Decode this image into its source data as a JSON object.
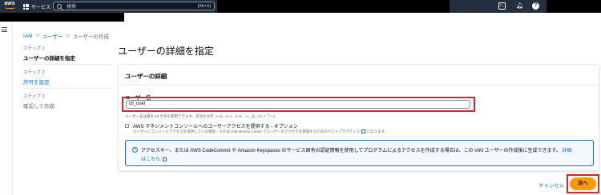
{
  "topbar": {
    "logo_text": "aws",
    "services_label": "サービス",
    "search_placeholder": "検索",
    "search_shortcut": "[Alt+S]",
    "cloudshell_icon": "cloudshell-icon",
    "bell_icon": "bell-icon",
    "help_icon": "help-icon"
  },
  "breadcrumb": {
    "items": [
      "IAM",
      "ユーザー"
    ],
    "separator": ">",
    "current": "ユーザーの作成"
  },
  "steps": [
    {
      "num": "ステップ 1",
      "title": "ユーザーの詳細を指定",
      "state": "active"
    },
    {
      "num": "ステップ 2",
      "title": "許可を設定",
      "state": "link"
    },
    {
      "num": "ステップ 3",
      "title": "確認して作成",
      "state": "inactive"
    }
  ],
  "page_title": "ユーザーの詳細を指定",
  "panel": {
    "header": "ユーザーの詳細",
    "username_label": "ユーザー名",
    "username_value": "cli_user",
    "constraint": "ユーザー名は最大 64 文字を使用できます。有効な文字: A~Z、a~z、0~9、+=,.@_-(ハイフン)",
    "console_access_label": "AWS マネジメントコンソールへのユーザーアクセスを提供する - オプション",
    "console_access_desc": "ユーザーにコンソールアクセスを提供している場合、それは IAM Identity Center でユーザーのアクセスを管理するためのベストプラクティス",
    "console_access_desc_suffix": "になります。",
    "info_text": "アクセスキー、または AWS CodeCommit や Amazon Keyspaces のサービス固有の認証情報を使用してプログラムによるアクセスを作成する場合は、この IAM ユーザーの作成後に生成できます。",
    "info_link": "詳細はこちら"
  },
  "footer": {
    "cancel_label": "キャンセル",
    "next_label": "次へ"
  },
  "colors": {
    "topbar": "#232f3e",
    "link": "#0972d3",
    "primary": "#ff9900",
    "highlight": "#d1282e"
  }
}
